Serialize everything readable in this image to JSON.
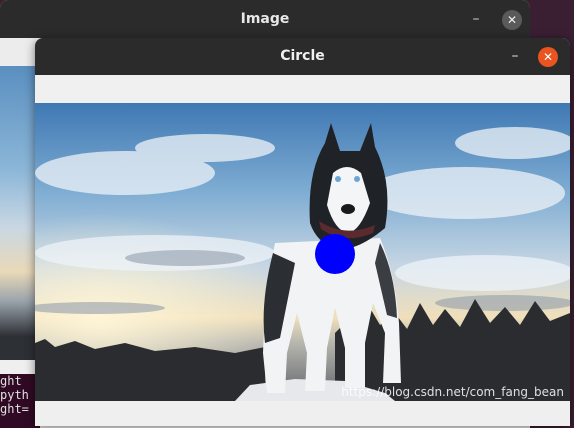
{
  "windows": {
    "back": {
      "title": "Image",
      "minimize_label": "–",
      "close_label": "✕"
    },
    "front": {
      "title": "Circle",
      "minimize_label": "–",
      "close_label": "✕"
    }
  },
  "terminal_lines": [
    "ght",
    "pyth",
    "ght="
  ],
  "canvas": {
    "subject": "husky-dog",
    "circle_color": "#0000ff",
    "watermark": "https://blog.csdn.net/com_fang_bean"
  },
  "colors": {
    "titlebar": "#2b2b2b",
    "close_active": "#e95420",
    "desktop": "#3a1f33"
  }
}
